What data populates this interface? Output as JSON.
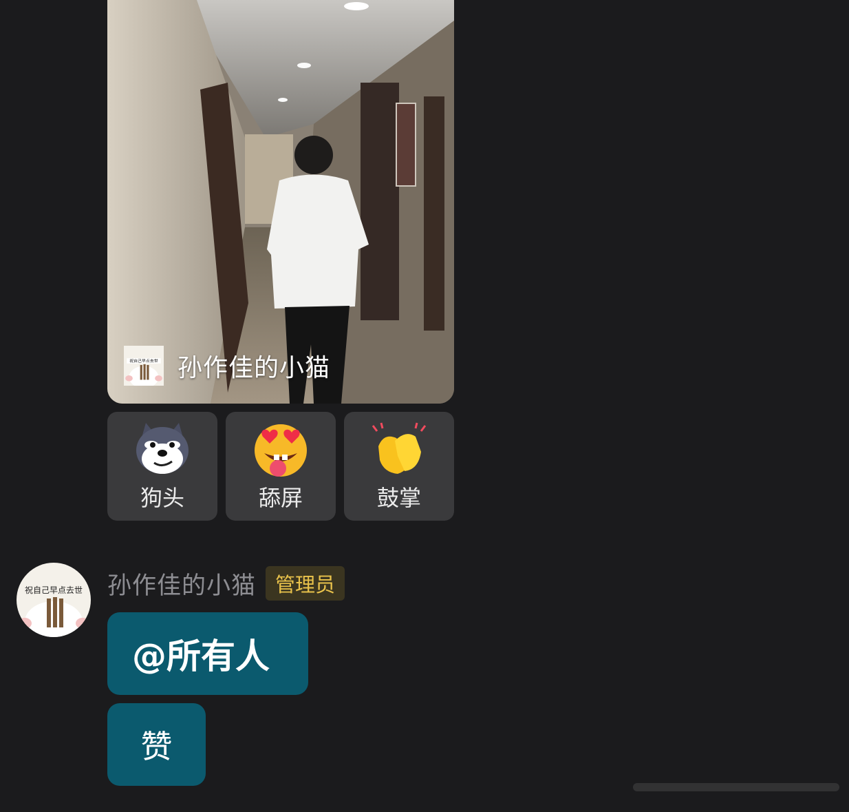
{
  "photo_post": {
    "author_name": "孙作佳的小猫",
    "avatar_icon": "bunny-with-chopsticks-avatar",
    "avatar_caption": "祝自己早点去世"
  },
  "reactions": [
    {
      "label": "狗头",
      "icon": "dog-head-emoji"
    },
    {
      "label": "舔屏",
      "icon": "heart-eyes-tongue-emoji"
    },
    {
      "label": "鼓掌",
      "icon": "clapping-hands-emoji"
    }
  ],
  "message": {
    "sender_name": "孙作佳的小猫",
    "role_badge": "管理员",
    "avatar_caption": "祝自己早点去世",
    "bubbles": [
      {
        "text": "@所有人"
      },
      {
        "text": "赞"
      }
    ]
  },
  "colors": {
    "background": "#1b1b1d",
    "reaction_bg": "#3a3a3c",
    "bubble_bg": "#0b5a6e",
    "badge_text": "#e9c24b",
    "badge_bg": "#3b3520",
    "sender_text": "#8d8d92"
  }
}
